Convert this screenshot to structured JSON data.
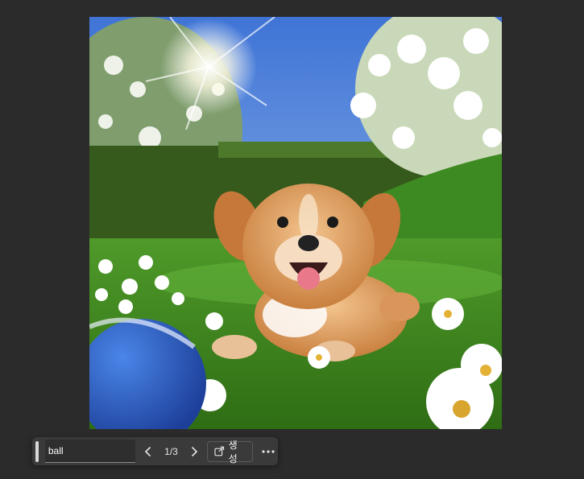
{
  "image": {
    "alt_name": "puppy-on-grass"
  },
  "toolbar": {
    "prompt_value": "ball",
    "counter": "1/3",
    "generate_label": "생성",
    "prev_icon": "chevron-left-icon",
    "next_icon": "chevron-right-icon",
    "generate_icon": "generate-icon",
    "more_icon": "more-horizontal-icon"
  },
  "colors": {
    "background": "#2b2b2b",
    "toolbar": "#3a3a3a",
    "text": "#f0f0f0"
  }
}
